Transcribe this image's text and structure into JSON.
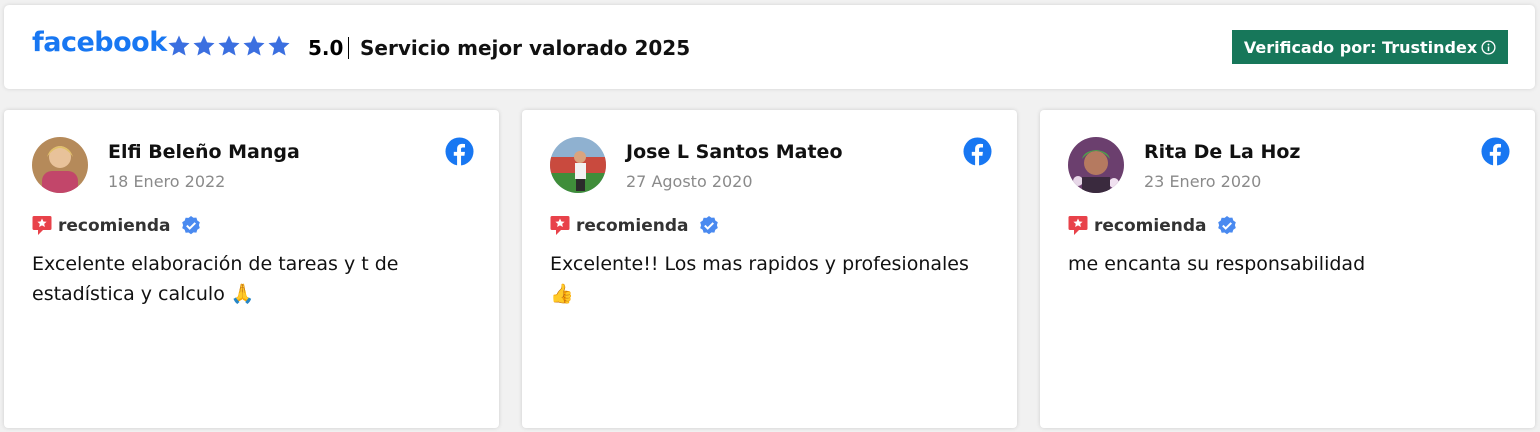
{
  "header": {
    "logo": "facebook",
    "rating": "5.0",
    "title": "Servicio mejor valorado 2025",
    "verified_label": "Verificado por: Trustindex",
    "star_color": "#3b6fe0",
    "brand_color": "#1877f2",
    "verified_bg": "#17775a"
  },
  "reviews": [
    {
      "name": "Elfi Beleño Manga",
      "date": "18 Enero 2022",
      "badge": "recomienda",
      "text": "Excelente elaboración de tareas y t de estadística y calculo 🙏"
    },
    {
      "name": "Jose L Santos Mateo",
      "date": "27 Agosto 2020",
      "badge": "recomienda",
      "text": "Excelente!! Los mas rapidos y profesionales 👍"
    },
    {
      "name": "Rita De La Hoz",
      "date": "23 Enero 2020",
      "badge": "recomienda",
      "text": "me encanta su responsabilidad"
    }
  ],
  "icons": {
    "platform": "facebook-icon",
    "recommend": "recommend-icon",
    "verified": "verified-check-icon",
    "info": "info-icon"
  }
}
